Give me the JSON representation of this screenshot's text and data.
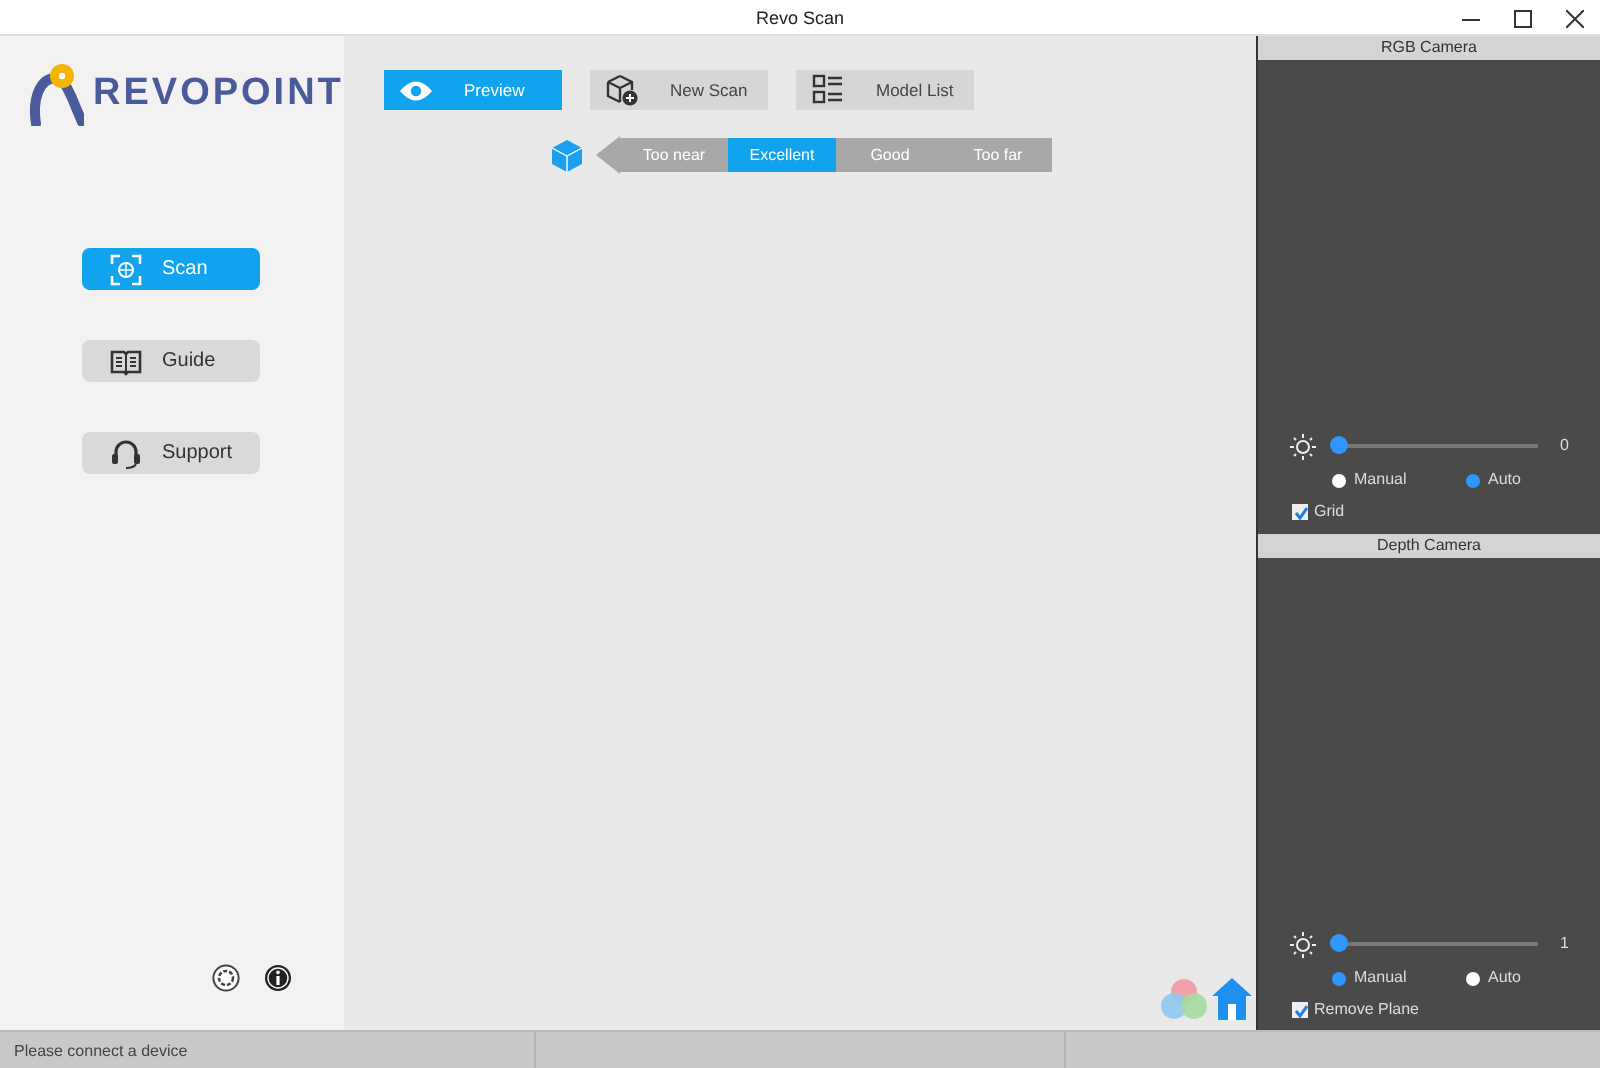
{
  "window": {
    "title": "Revo Scan"
  },
  "logo": {
    "text": "REVOPOINT"
  },
  "sidebar": {
    "items": [
      {
        "label": "Scan",
        "selected": true
      },
      {
        "label": "Guide",
        "selected": false
      },
      {
        "label": "Support",
        "selected": false
      }
    ]
  },
  "toolbar": {
    "buttons": [
      {
        "label": "Preview",
        "selected": true
      },
      {
        "label": "New Scan",
        "selected": false
      },
      {
        "label": "Model List",
        "selected": false
      }
    ]
  },
  "distance_indicator": {
    "segments": [
      {
        "label": "Too near",
        "selected": false
      },
      {
        "label": "Excellent",
        "selected": true
      },
      {
        "label": "Good",
        "selected": false
      },
      {
        "label": "Too far",
        "selected": false
      }
    ]
  },
  "rgb_camera": {
    "title": "RGB Camera",
    "exposure": {
      "level": 0,
      "reading": "0"
    },
    "modes": [
      {
        "label": "Manual",
        "selected": false
      },
      {
        "label": "Auto",
        "selected": true
      }
    ],
    "option": {
      "label": "Grid",
      "checked": true
    }
  },
  "depth_camera": {
    "title": "Depth Camera",
    "exposure": {
      "level": 0,
      "reading": "1"
    },
    "modes": [
      {
        "label": "Manual",
        "selected": true
      },
      {
        "label": "Auto",
        "selected": false
      }
    ],
    "option": {
      "label": "Remove Plane",
      "checked": true
    }
  },
  "status_bar": {
    "message": "Please connect a device"
  }
}
